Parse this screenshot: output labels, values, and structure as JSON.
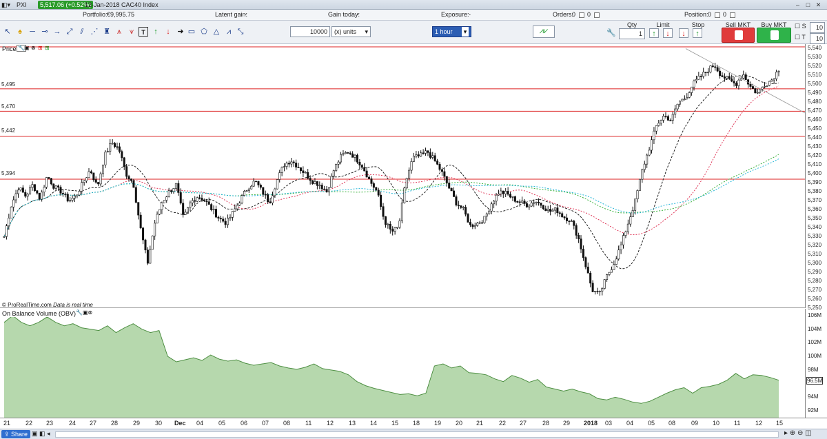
{
  "titlebar": {
    "app": "PXI",
    "price_change": "5,517.06 (+0.52%)",
    "date_instrument": "12-Jan-2018 CAC40 Index"
  },
  "infobar": {
    "portfolio_label": "Portfolio:",
    "portfolio_value": "€9,995.75",
    "latent_gain_label": "Latent gain:",
    "latent_gain_value": "-",
    "gain_today_label": "Gain today:",
    "gain_today_value": "-",
    "exposure_label": "Exposure:",
    "exposure_value": "-",
    "orders_label": "Orders:",
    "orders_value": "0",
    "orders_count": "0",
    "position_label": "Position:",
    "position_value": "0",
    "position_count": "0"
  },
  "toolbar": {
    "quantity_value": "10000",
    "units_select": "(x) units",
    "timeframe_select": "1 hour",
    "qty_label": "Qty",
    "qty_value": "1",
    "limit_label": "Limit",
    "stop_label": "Stop",
    "sell_label": "Sell MKT",
    "buy_label": "Buy MKT",
    "s_label": "S",
    "s_value": "10",
    "t_label": "T",
    "t_value": "10"
  },
  "price_pane": {
    "header": "Price",
    "hlines": [
      "5,495",
      "5,470",
      "5,442",
      "5,394"
    ],
    "footer": "© ProRealTime.com",
    "footer_note": "Data is real time",
    "yticks": [
      "5,540",
      "5,530",
      "5,520",
      "5,510",
      "5,500",
      "5,490",
      "5,480",
      "5,470",
      "5,460",
      "5,450",
      "5,440",
      "5,430",
      "5,420",
      "5,410",
      "5,400",
      "5,390",
      "5,380",
      "5,370",
      "5,360",
      "5,350",
      "5,340",
      "5,330",
      "5,320",
      "5,310",
      "5,300",
      "5,290",
      "5,280",
      "5,270",
      "5,260",
      "5,250"
    ]
  },
  "obv_pane": {
    "header": "On Balance Volume (OBV)",
    "yticks": [
      "106M",
      "104M",
      "102M",
      "100M",
      "98M",
      "96.5M",
      "94M",
      "92M"
    ],
    "last_value": "96.5M"
  },
  "xaxis": [
    "21",
    "22",
    "23",
    "24",
    "27",
    "28",
    "29",
    "30",
    "Dec",
    "04",
    "05",
    "06",
    "07",
    "08",
    "11",
    "12",
    "13",
    "14",
    "15",
    "18",
    "19",
    "20",
    "21",
    "22",
    "27",
    "28",
    "29",
    "2018",
    "03",
    "04",
    "05",
    "08",
    "09",
    "10",
    "11",
    "12",
    "15"
  ],
  "statusbar": {
    "share_label": "Share"
  },
  "colors": {
    "hline": "#d22",
    "obv_fill": "#b6d8ad",
    "obv_line": "#4e8f43",
    "sma_fast": "#222",
    "sma_mid": "#e03a5a",
    "sma_slow_a": "#37b03a",
    "sma_slow_b": "#26b6d8",
    "price_label_bg": "#2a9b2a"
  },
  "chart_data": {
    "type": "candlestick",
    "instrument": "CAC40 Index",
    "timeframe": "1 hour",
    "ylim": [
      5250,
      5545
    ],
    "obv_ylim": [
      91,
      107
    ],
    "horizontal_levels": [
      5495,
      5470,
      5442,
      5394
    ],
    "close_path": [
      5330,
      5365,
      5385,
      5375,
      5388,
      5372,
      5398,
      5385,
      5380,
      5370,
      5375,
      5390,
      5405,
      5385,
      5420,
      5435,
      5428,
      5400,
      5390,
      5340,
      5300,
      5345,
      5368,
      5380,
      5388,
      5350,
      5368,
      5375,
      5370,
      5360,
      5350,
      5345,
      5358,
      5372,
      5385,
      5392,
      5380,
      5368,
      5392,
      5410,
      5415,
      5408,
      5400,
      5392,
      5388,
      5380,
      5405,
      5420,
      5425,
      5418,
      5408,
      5392,
      5380,
      5348,
      5335,
      5340,
      5392,
      5418,
      5420,
      5425,
      5415,
      5402,
      5385,
      5368,
      5360,
      5342,
      5345,
      5350,
      5368,
      5380,
      5378,
      5372,
      5368,
      5365,
      5370,
      5365,
      5358,
      5360,
      5352,
      5348,
      5330,
      5300,
      5270,
      5265,
      5285,
      5300,
      5320,
      5345,
      5370,
      5405,
      5430,
      5455,
      5465,
      5460,
      5480,
      5485,
      5500,
      5508,
      5515,
      5522,
      5510,
      5505,
      5500,
      5512,
      5498,
      5490,
      5500,
      5505,
      5517
    ],
    "obv_path": [
      105,
      106,
      105,
      104.5,
      105,
      105.8,
      105,
      104.5,
      104.8,
      104.2,
      104,
      103.8,
      104.5,
      103.5,
      104.2,
      104.8,
      104,
      103.5,
      103.8,
      100,
      99.2,
      99.5,
      99.8,
      99.4,
      100.2,
      99.6,
      99.3,
      99.5,
      99,
      98.7,
      98.9,
      99.1,
      98.6,
      98.3,
      98.1,
      98.4,
      98.9,
      98.2,
      98,
      97.8,
      97.3,
      96.3,
      95.7,
      95.3,
      95,
      94.7,
      94.4,
      94.5,
      94.2,
      94.6,
      98.6,
      98.9,
      98.3,
      98.6,
      97.6,
      97.5,
      97.3,
      96.7,
      96.3,
      97.2,
      96.8,
      96.2,
      96.6,
      95.5,
      95.2,
      94.9,
      95.2,
      94.8,
      94.5,
      93.8,
      93.6,
      94,
      93.7,
      93.3,
      93.1,
      93.4,
      94,
      94.6,
      95.1,
      95.4,
      94.6,
      95.4,
      95.6,
      95.9,
      96.5,
      97.5,
      96.7,
      97.3,
      97.2,
      96.9,
      96.5
    ]
  }
}
